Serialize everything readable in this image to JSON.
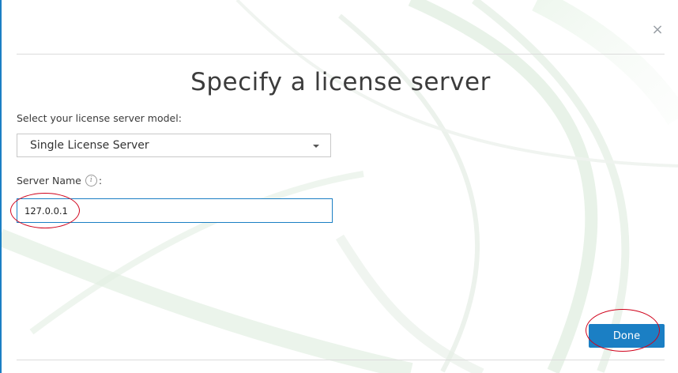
{
  "dialog": {
    "close_glyph": "×",
    "title": "Specify a license server"
  },
  "model": {
    "label": "Select your license server model:",
    "selected": "Single License Server"
  },
  "server": {
    "label": "Server Name",
    "label_suffix": ":",
    "info_glyph": "i",
    "value": "127.0.0.1"
  },
  "actions": {
    "done_label": "Done"
  },
  "colors": {
    "accent": "#1b7fc4",
    "annotation": "#d0021b"
  },
  "icons": [
    "close-icon",
    "info-icon",
    "chevron-down-icon"
  ]
}
